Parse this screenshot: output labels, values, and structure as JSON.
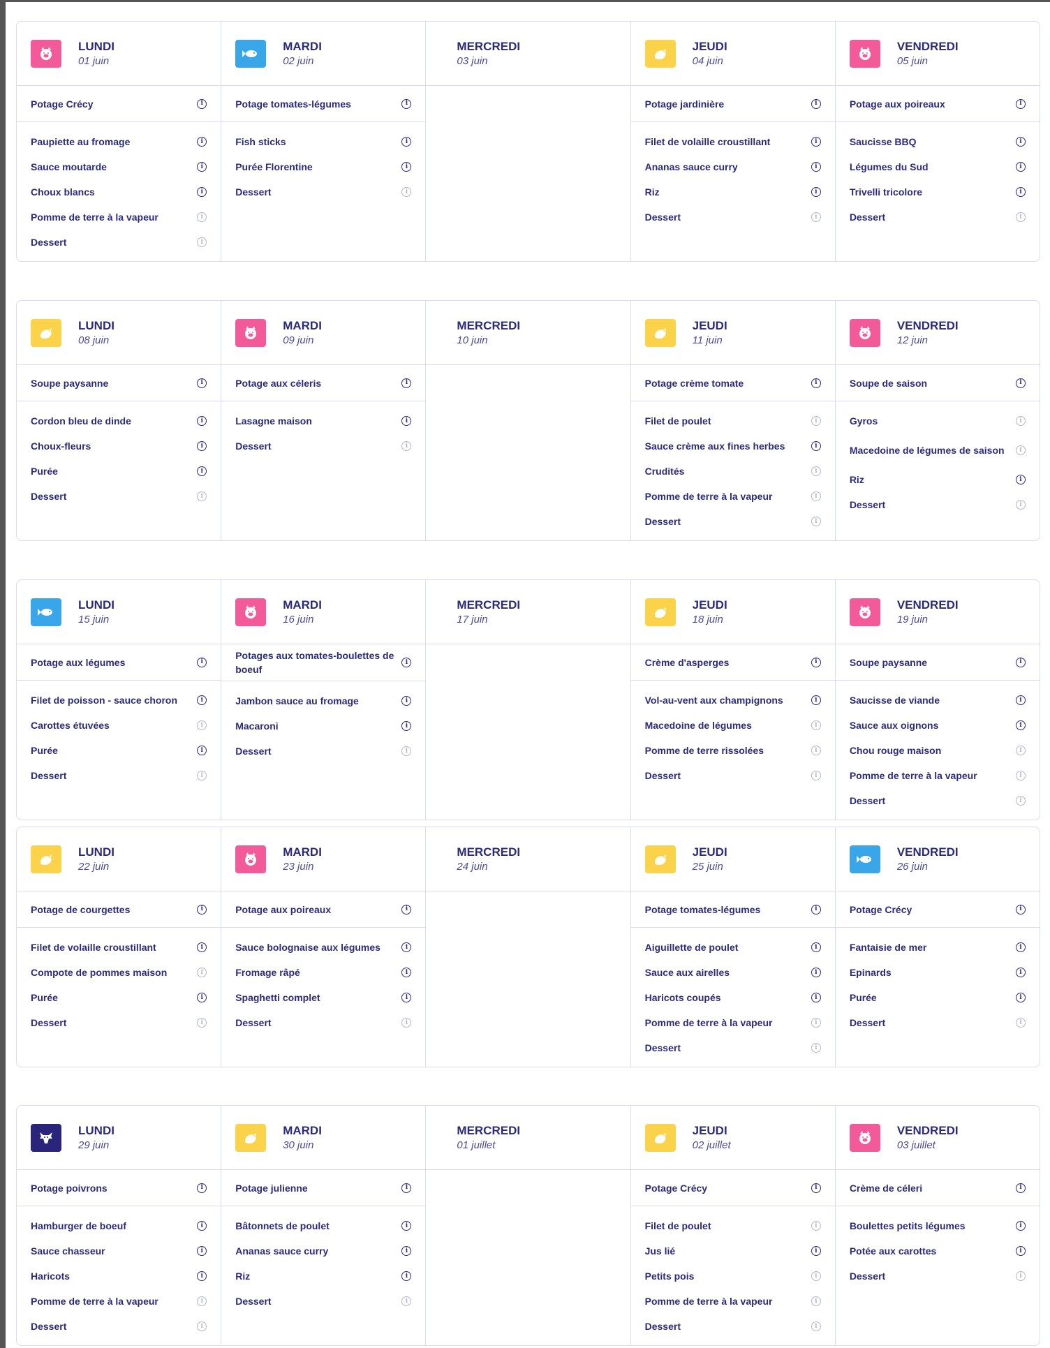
{
  "icons": {
    "pig": "pig-icon",
    "fish": "fish-icon",
    "chicken": "chicken-icon",
    "beef": "beef-icon"
  },
  "colors": {
    "pig": "#f25a9a",
    "fish": "#3aa6ea",
    "chicken": "#fbd34a",
    "beef": "#2a247a",
    "text": "#2c2a7a"
  },
  "info_glyph": "i",
  "weeks": [
    {
      "days": [
        {
          "name": "LUNDI",
          "date": "01 juin",
          "icon": "pig",
          "soup": {
            "label": "Potage Crécy",
            "info": "dark"
          },
          "items": [
            {
              "label": "Paupiette au fromage",
              "info": "dark"
            },
            {
              "label": "Sauce moutarde",
              "info": "dark"
            },
            {
              "label": "Choux blancs",
              "info": "dark"
            },
            {
              "label": "Pomme de terre à la vapeur",
              "info": "dim"
            },
            {
              "label": "Dessert",
              "info": "dim"
            }
          ]
        },
        {
          "name": "MARDI",
          "date": "02 juin",
          "icon": "fish",
          "soup": {
            "label": "Potage tomates-légumes",
            "info": "dark"
          },
          "items": [
            {
              "label": "Fish sticks",
              "info": "dark"
            },
            {
              "label": "Purée Florentine",
              "info": "dark"
            },
            {
              "label": "Dessert",
              "info": "dim"
            }
          ]
        },
        {
          "name": "MERCREDI",
          "date": "03 juin",
          "icon": null,
          "soup": null,
          "items": []
        },
        {
          "name": "JEUDI",
          "date": "04 juin",
          "icon": "chicken",
          "soup": {
            "label": "Potage jardinière",
            "info": "dark"
          },
          "items": [
            {
              "label": "Filet de volaille croustillant",
              "info": "dark"
            },
            {
              "label": "Ananas sauce curry",
              "info": "dark"
            },
            {
              "label": "Riz",
              "info": "dark"
            },
            {
              "label": "Dessert",
              "info": "dim"
            }
          ]
        },
        {
          "name": "VENDREDI",
          "date": "05 juin",
          "icon": "pig",
          "soup": {
            "label": "Potage aux poireaux",
            "info": "dark"
          },
          "items": [
            {
              "label": "Saucisse BBQ",
              "info": "dark"
            },
            {
              "label": "Légumes du Sud",
              "info": "dark"
            },
            {
              "label": "Trivelli tricolore",
              "info": "dark"
            },
            {
              "label": "Dessert",
              "info": "dim"
            }
          ]
        }
      ]
    },
    {
      "days": [
        {
          "name": "LUNDI",
          "date": "08 juin",
          "icon": "chicken",
          "soup": {
            "label": "Soupe paysanne",
            "info": "dark"
          },
          "items": [
            {
              "label": "Cordon bleu de dinde",
              "info": "dark"
            },
            {
              "label": "Choux-fleurs",
              "info": "dark"
            },
            {
              "label": "Purée",
              "info": "dark"
            },
            {
              "label": "Dessert",
              "info": "dim"
            }
          ]
        },
        {
          "name": "MARDI",
          "date": "09 juin",
          "icon": "pig",
          "soup": {
            "label": "Potage aux céleris",
            "info": "dark"
          },
          "items": [
            {
              "label": "Lasagne maison",
              "info": "dark"
            },
            {
              "label": "Dessert",
              "info": "dim"
            }
          ]
        },
        {
          "name": "MERCREDI",
          "date": "10 juin",
          "icon": null,
          "soup": null,
          "items": []
        },
        {
          "name": "JEUDI",
          "date": "11 juin",
          "icon": "chicken",
          "soup": {
            "label": "Potage crème tomate",
            "info": "dark"
          },
          "items": [
            {
              "label": "Filet de poulet",
              "info": "dim"
            },
            {
              "label": "Sauce crème aux fines herbes",
              "info": "dark"
            },
            {
              "label": "Crudités",
              "info": "dim"
            },
            {
              "label": "Pomme de terre à la vapeur",
              "info": "dim"
            },
            {
              "label": "Dessert",
              "info": "dim"
            }
          ]
        },
        {
          "name": "VENDREDI",
          "date": "12 juin",
          "icon": "pig",
          "soup": {
            "label": "Soupe de saison",
            "info": "dark"
          },
          "items": [
            {
              "label": "Gyros",
              "info": "dim"
            },
            {
              "label": "Macedoine de légumes de saison",
              "info": "dim",
              "two": true
            },
            {
              "label": "Riz",
              "info": "dark"
            },
            {
              "label": "Dessert",
              "info": "dim"
            }
          ]
        }
      ]
    },
    {
      "days": [
        {
          "name": "LUNDI",
          "date": "15 juin",
          "icon": "fish",
          "soup": {
            "label": "Potage aux légumes",
            "info": "dark"
          },
          "items": [
            {
              "label": "Filet de poisson - sauce choron",
              "info": "dark"
            },
            {
              "label": "Carottes étuvées",
              "info": "dim"
            },
            {
              "label": "Purée",
              "info": "dark"
            },
            {
              "label": "Dessert",
              "info": "dim"
            }
          ]
        },
        {
          "name": "MARDI",
          "date": "16 juin",
          "icon": "pig",
          "soup": {
            "label": "Potages aux tomates-boulettes de boeuf",
            "info": "dark"
          },
          "items": [
            {
              "label": "Jambon sauce au fromage",
              "info": "dark"
            },
            {
              "label": "Macaroni",
              "info": "dark"
            },
            {
              "label": "Dessert",
              "info": "dim"
            }
          ]
        },
        {
          "name": "MERCREDI",
          "date": "17 juin",
          "icon": null,
          "soup": null,
          "items": []
        },
        {
          "name": "JEUDI",
          "date": "18 juin",
          "icon": "chicken",
          "soup": {
            "label": "Crème d'asperges",
            "info": "dark"
          },
          "items": [
            {
              "label": "Vol-au-vent aux champignons",
              "info": "dark"
            },
            {
              "label": "Macedoine de légumes",
              "info": "dim"
            },
            {
              "label": "Pomme de terre rissolées",
              "info": "dim"
            },
            {
              "label": "Dessert",
              "info": "dim"
            }
          ]
        },
        {
          "name": "VENDREDI",
          "date": "19 juin",
          "icon": "pig",
          "soup": {
            "label": "Soupe paysanne",
            "info": "dark"
          },
          "items": [
            {
              "label": "Saucisse de viande",
              "info": "dark"
            },
            {
              "label": "Sauce aux oignons",
              "info": "dark"
            },
            {
              "label": "Chou rouge maison",
              "info": "dim"
            },
            {
              "label": "Pomme de terre à la vapeur",
              "info": "dim"
            },
            {
              "label": "Dessert",
              "info": "dim"
            }
          ]
        }
      ]
    },
    {
      "days": [
        {
          "name": "LUNDI",
          "date": "22 juin",
          "icon": "chicken",
          "soup": {
            "label": "Potage de courgettes",
            "info": "dark"
          },
          "items": [
            {
              "label": "Filet de volaille croustillant",
              "info": "dark"
            },
            {
              "label": "Compote de pommes maison",
              "info": "dim"
            },
            {
              "label": "Purée",
              "info": "dark"
            },
            {
              "label": "Dessert",
              "info": "dim"
            }
          ]
        },
        {
          "name": "MARDI",
          "date": "23 juin",
          "icon": "pig",
          "soup": {
            "label": "Potage aux poireaux",
            "info": "dark"
          },
          "items": [
            {
              "label": "Sauce bolognaise aux légumes",
              "info": "dark"
            },
            {
              "label": "Fromage râpé",
              "info": "dark"
            },
            {
              "label": "Spaghetti complet",
              "info": "dark"
            },
            {
              "label": "Dessert",
              "info": "dim"
            }
          ]
        },
        {
          "name": "MERCREDI",
          "date": "24 juin",
          "icon": null,
          "soup": null,
          "items": []
        },
        {
          "name": "JEUDI",
          "date": "25 juin",
          "icon": "chicken",
          "soup": {
            "label": "Potage tomates-légumes",
            "info": "dark"
          },
          "items": [
            {
              "label": "Aiguillette de poulet",
              "info": "dark"
            },
            {
              "label": "Sauce aux airelles",
              "info": "dark"
            },
            {
              "label": "Haricots coupés",
              "info": "dark"
            },
            {
              "label": "Pomme de terre à la vapeur",
              "info": "dim"
            },
            {
              "label": "Dessert",
              "info": "dim"
            }
          ]
        },
        {
          "name": "VENDREDI",
          "date": "26 juin",
          "icon": "fish",
          "soup": {
            "label": "Potage Crécy",
            "info": "dark"
          },
          "items": [
            {
              "label": "Fantaisie de mer",
              "info": "dark"
            },
            {
              "label": "Epinards",
              "info": "dark"
            },
            {
              "label": "Purée",
              "info": "dark"
            },
            {
              "label": "Dessert",
              "info": "dim"
            }
          ]
        }
      ]
    },
    {
      "days": [
        {
          "name": "LUNDI",
          "date": "29 juin",
          "icon": "beef",
          "soup": {
            "label": "Potage poivrons",
            "info": "dark"
          },
          "items": [
            {
              "label": "Hamburger de boeuf",
              "info": "dark"
            },
            {
              "label": "Sauce chasseur",
              "info": "dark"
            },
            {
              "label": "Haricots",
              "info": "dark"
            },
            {
              "label": "Pomme de terre à la vapeur",
              "info": "dim"
            },
            {
              "label": "Dessert",
              "info": "dim"
            }
          ]
        },
        {
          "name": "MARDI",
          "date": "30 juin",
          "icon": "chicken",
          "soup": {
            "label": "Potage julienne",
            "info": "dark"
          },
          "items": [
            {
              "label": "Bâtonnets de poulet",
              "info": "dark"
            },
            {
              "label": "Ananas sauce curry",
              "info": "dark"
            },
            {
              "label": "Riz",
              "info": "dark"
            },
            {
              "label": "Dessert",
              "info": "dim"
            }
          ]
        },
        {
          "name": "MERCREDI",
          "date": "01 juillet",
          "icon": null,
          "soup": null,
          "items": []
        },
        {
          "name": "JEUDI",
          "date": "02 juillet",
          "icon": "chicken",
          "soup": {
            "label": "Potage Crécy",
            "info": "dark"
          },
          "items": [
            {
              "label": "Filet de poulet",
              "info": "dim"
            },
            {
              "label": "Jus lié",
              "info": "dark"
            },
            {
              "label": "Petits pois",
              "info": "dim"
            },
            {
              "label": "Pomme de terre à la vapeur",
              "info": "dim"
            },
            {
              "label": "Dessert",
              "info": "dim"
            }
          ]
        },
        {
          "name": "VENDREDI",
          "date": "03 juillet",
          "icon": "pig",
          "soup": {
            "label": "Crème de céleri",
            "info": "dark"
          },
          "items": [
            {
              "label": "Boulettes petits légumes",
              "info": "dark"
            },
            {
              "label": "Potée aux carottes",
              "info": "dark"
            },
            {
              "label": "Dessert",
              "info": "dim"
            }
          ]
        }
      ]
    }
  ]
}
